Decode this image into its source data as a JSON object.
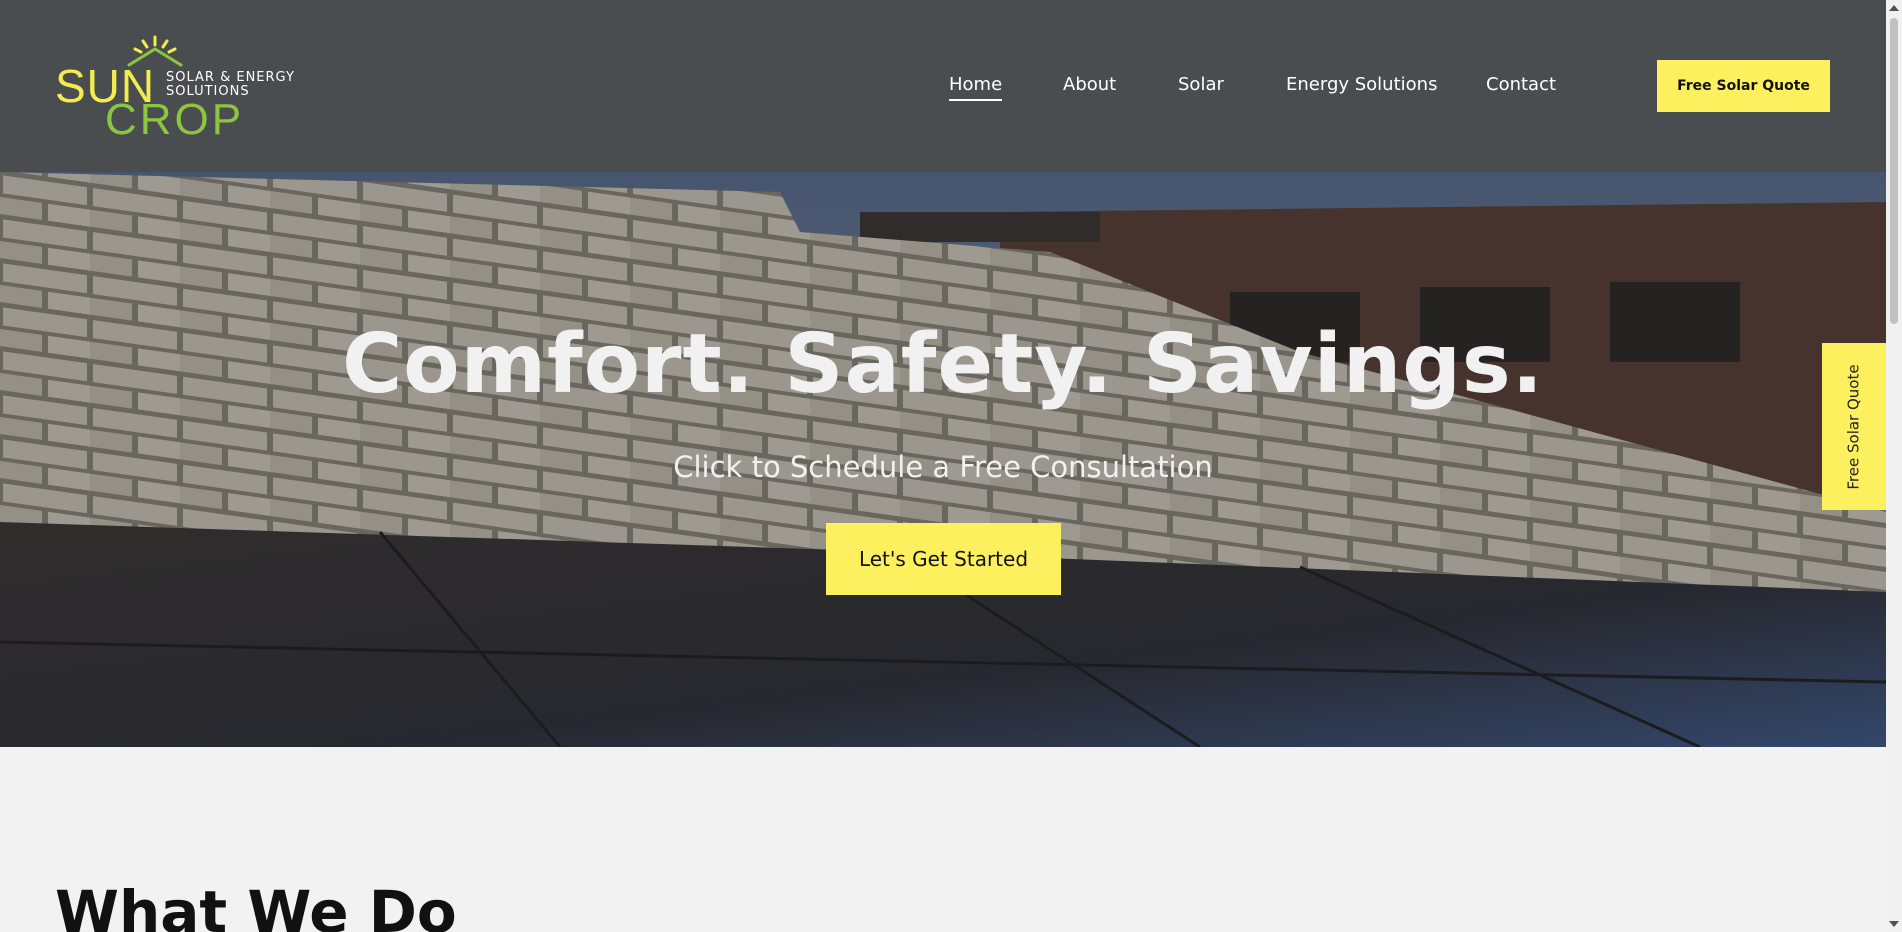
{
  "logo": {
    "word_top": "SUN",
    "word_bottom": "CROP",
    "tagline_line1": "SOLAR & ENERGY",
    "tagline_line2": "SOLUTIONS",
    "icon": "sun-house-icon"
  },
  "nav": {
    "items": [
      {
        "label": "Home",
        "active": true
      },
      {
        "label": "About"
      },
      {
        "label": "Solar"
      },
      {
        "label": "Energy Solutions"
      },
      {
        "label": "Contact"
      }
    ]
  },
  "header": {
    "quote_button": "Free Solar Quote"
  },
  "hero": {
    "headline": "Comfort. Safety. Savings.",
    "subheadline": "Click to Schedule a Free Consultation",
    "cta_label": "Let's Get Started"
  },
  "side_tab": {
    "label": "Free Solar Quote"
  },
  "section": {
    "title": "What We Do"
  },
  "colors": {
    "header_bg": "#4a4d4f",
    "accent_yellow": "#fdf05f",
    "logo_yellow": "#f3ec4e",
    "logo_green": "#8cc63f",
    "page_bg": "#f2f2f2"
  }
}
